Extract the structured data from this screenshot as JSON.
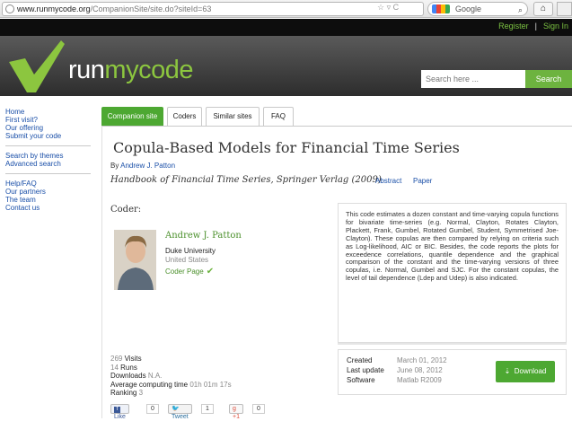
{
  "browser": {
    "url_domain": "www.runmycode.org",
    "url_path": "/CompanionSite/site.do?siteId=63",
    "search_engine": "Google"
  },
  "header": {
    "register": "Register",
    "sign_in": "Sign In",
    "logo_part1": "run",
    "logo_part2": "mycode",
    "search_placeholder": "Search here ...",
    "search_button": "Search"
  },
  "sidebar": {
    "groups": [
      [
        "Home",
        "First visit?",
        "Our offering",
        "Submit your code"
      ],
      [
        "Search by themes",
        "Advanced search"
      ],
      [
        "Help/FAQ",
        "Our partners",
        "The team",
        "Contact us"
      ]
    ]
  },
  "tabs": [
    "Companion site",
    "Coders",
    "Similar sites",
    "FAQ"
  ],
  "article": {
    "title": "Copula-Based Models for Financial Time Series",
    "by": "By",
    "author": "Andrew J. Patton",
    "journal": "Handbook of Financial Time Series, Springer Verlag (2009)",
    "abstract_link": "Abstract",
    "paper_link": "Paper"
  },
  "coder": {
    "heading": "Coder:",
    "name": "Andrew J. Patton",
    "university": "Duke University",
    "country": "United States",
    "page_link": "Coder Page"
  },
  "description": "This code estimates a dozen constant and time-varying copula functions for bivariate time-series (e.g. Normal, Clayton, Rotates Clayton, Plackett, Frank, Gumbel, Rotated Gumbel, Student, Symmetrised Joe-Clayton). These copulas are then compared by relying on criteria such as Log-likelihood, AIC or BIC. Besides, the code reports the plots for exceedence correlations, quantile dependence and the graphical comparison of the constant and the time-varying versions of three copulas, i.e. Normal, Gumbel and SJC. For the constant copulas, the level of tail dependence (Ldep and Udep) is also indicated.",
  "stats": {
    "visits_n": "269",
    "visits_label": "Visits",
    "runs_n": "14",
    "runs_label": "Runs",
    "downloads_label": "Downloads",
    "downloads_n": "N.A.",
    "avg_label": "Average computing time",
    "avg_val": "01h 01m 17s",
    "ranking_label": "Ranking",
    "ranking_val": "3"
  },
  "social": {
    "like": "Like",
    "like_count": "0",
    "tweet": "Tweet",
    "tweet_count": "1",
    "gplus": "+1",
    "gplus_count": "0"
  },
  "meta": {
    "created_label": "Created",
    "created_val": "March 01, 2012",
    "update_label": "Last update",
    "update_val": "June 08, 2012",
    "software_label": "Software",
    "software_val": "Matlab R2009",
    "download": "Download"
  }
}
